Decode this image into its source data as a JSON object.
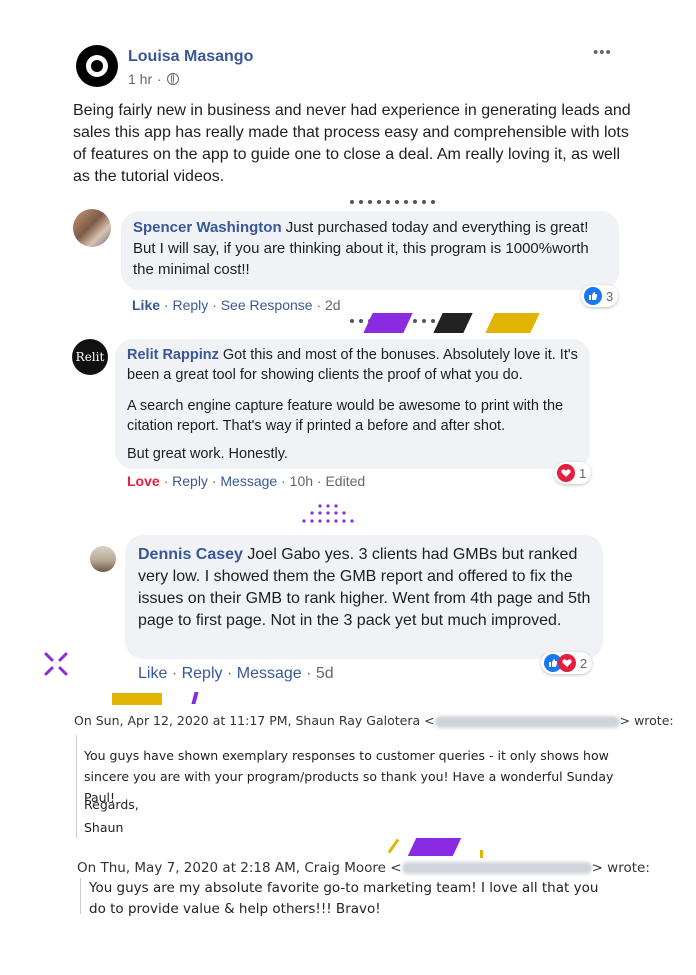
{
  "post": {
    "author": "Louisa Masango",
    "time": "1 hr",
    "more_label": "•••",
    "body": "Being fairly new in business and never had experience in generating leads and sales this app has really made that process easy and comprehensible with lots of features on the app to guide one to close a deal. Am really loving it, as well as the tutorial videos."
  },
  "comments": [
    {
      "author": "Spencer Washington",
      "text": "Just purchased today and everything is great! But I will say, if you are thinking about it, this program is 1000%worth the minimal cost!!",
      "actions": {
        "like": "Like",
        "reply": "Reply",
        "see": "See Response",
        "time": "2d"
      },
      "reactions": {
        "count": "3",
        "icons": [
          "like-icon"
        ]
      }
    },
    {
      "author": "Relit Rappinz",
      "avatar_text": "Relit",
      "text": "Got this and most of the bonuses. Absolutely love it. It's been a great tool for showing clients the proof of what you do.",
      "para2": "A search engine capture feature would be awesome to print with the citation report. That's way if printed a before and after shot.",
      "para3": "But great work. Honestly.",
      "actions": {
        "love": "Love",
        "reply": "Reply",
        "message": "Message",
        "time": "10h",
        "edited": "Edited"
      },
      "reactions": {
        "count": "1",
        "icons": [
          "heart-icon"
        ]
      }
    },
    {
      "author": "Dennis Casey",
      "text": "Joel Gabo yes. 3 clients had GMBs but ranked very low. I showed them the GMB report and offered to fix the issues on their GMB to rank higher. Went from 4th page and 5th page to first page. Not in the 3 pack yet but much improved.",
      "actions": {
        "like": "Like",
        "reply": "Reply",
        "message": "Message",
        "time": "5d"
      },
      "reactions": {
        "count": "2",
        "icons": [
          "like-icon",
          "heart-icon"
        ]
      }
    }
  ],
  "emails": [
    {
      "header_prefix": "On Sun, Apr 12, 2020 at 11:17 PM, Shaun Ray Galotera",
      "header_suffix": "wrote:",
      "body": "You guys have shown exemplary responses to customer queries - it only shows how sincere you are with your program/products so thank you!  Have a wonderful Sunday Paul!",
      "regards": "Regards,",
      "signature": "Shaun"
    },
    {
      "header_prefix": "On Thu, May 7, 2020 at 2:18 AM, Craig Moore",
      "header_suffix": "wrote:",
      "body": "You guys are my absolute favorite go-to marketing team! I love all that you do to provide value & help others!!! Bravo!"
    }
  ],
  "colors": {
    "link": "#385898",
    "love": "#e41e3f",
    "like": "#1877f2",
    "accent_purple": "#8a2be2",
    "accent_yellow": "#e0b400",
    "accent_black": "#222222"
  }
}
